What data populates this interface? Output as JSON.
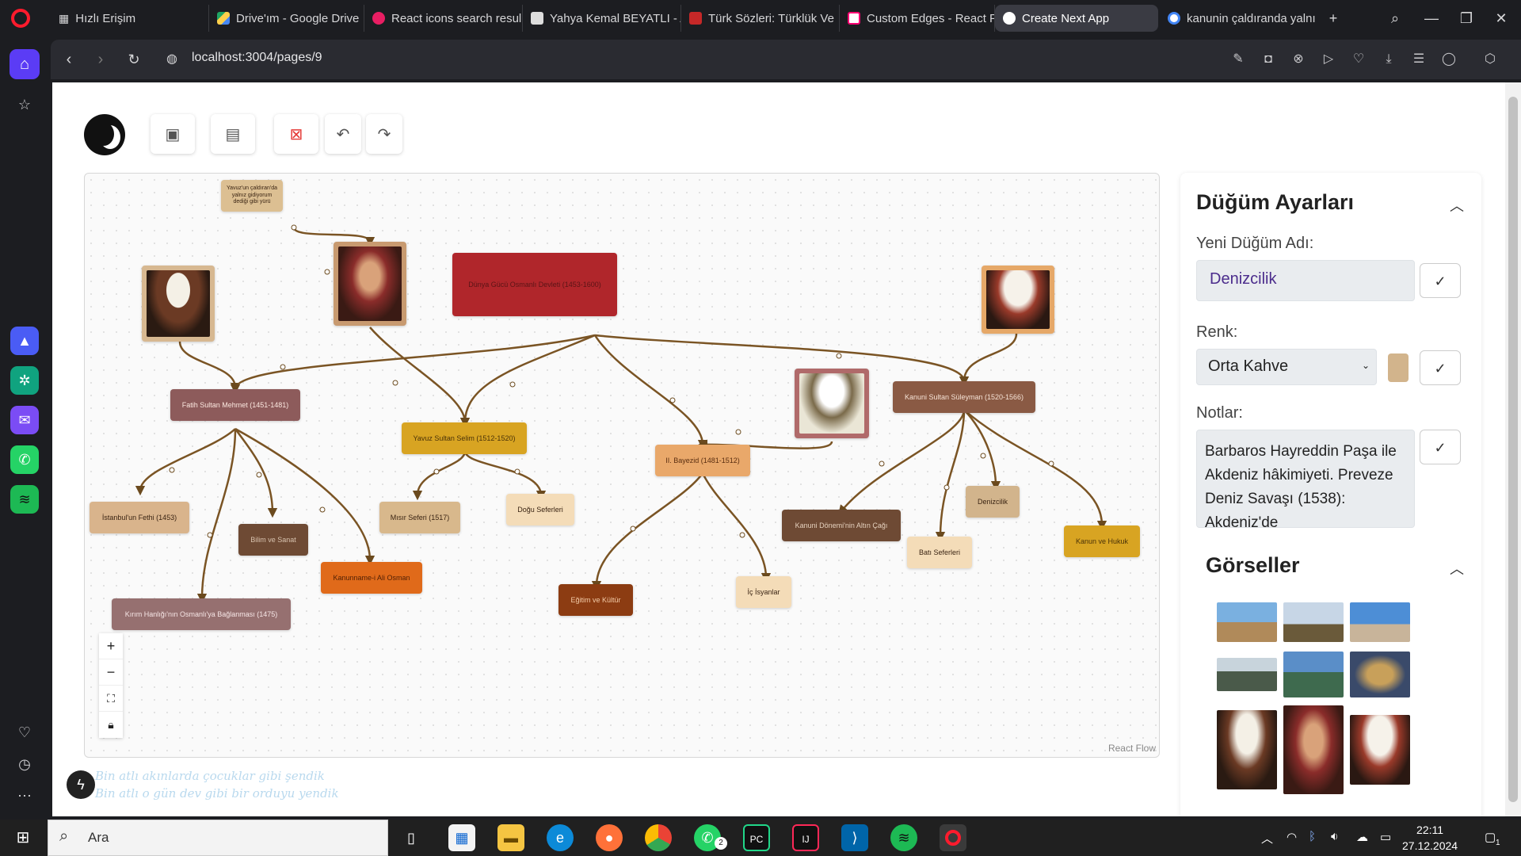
{
  "browser": {
    "tabs": [
      {
        "label": "Hızlı Erişim"
      },
      {
        "label": "Drive'ım - Google Drive"
      },
      {
        "label": "React icons search resul"
      },
      {
        "label": "Yahya Kemal BEYATLI - A"
      },
      {
        "label": "Türk Sözleri: Türklük Ve"
      },
      {
        "label": "Custom Edges - React Fl"
      },
      {
        "label": "Create Next App"
      },
      {
        "label": "kanunin çaldıranda yalnı"
      }
    ],
    "url": "localhost:3004/pages/9"
  },
  "flow": {
    "nodes": [
      {
        "label": "Yavuz'un çaldıran'da yalnız gidiyorum dediği gibi yürü"
      },
      {
        "label": "Dünya Gücü Osmanlı Devleti (1453-1600)"
      },
      {
        "label": "Fatih Sultan Mehmet (1451-1481)"
      },
      {
        "label": "Yavuz Sultan Selim (1512-1520)"
      },
      {
        "label": "II. Bayezid (1481-1512)"
      },
      {
        "label": "Kanuni Sultan Süleyman (1520-1566)"
      },
      {
        "label": "İstanbul'un Fethi (1453)"
      },
      {
        "label": "Bilim ve Sanat"
      },
      {
        "label": "Kanunname-i Ali Osman"
      },
      {
        "label": "Kırım Hanlığı'nın Osmanlı'ya Bağlanması (1475)"
      },
      {
        "label": "Mısır Seferi (1517)"
      },
      {
        "label": "Doğu Seferleri"
      },
      {
        "label": "Eğitim ve Kültür"
      },
      {
        "label": "İç İsyanlar"
      },
      {
        "label": "Kanuni Dönemi'nin Altın Çağı"
      },
      {
        "label": "Batı Seferleri"
      },
      {
        "label": "Denizcilik"
      },
      {
        "label": "Kanun ve Hukuk"
      }
    ],
    "attribution": "React Flow"
  },
  "poem": {
    "line1": "Bin atlı akınlarda çocuklar gibi şendik",
    "line2": "Bin atlı o gün dev gibi bir orduyu yendik"
  },
  "panel": {
    "title": "Düğüm Ayarları",
    "name_label": "Yeni Düğüm Adı:",
    "name_value": "Denizcilik",
    "color_label": "Renk:",
    "color_value": "Orta Kahve",
    "color_swatch": "#d2b48c",
    "notes_label": "Notlar:",
    "notes_value": "Barbaros Hayreddin Paşa ile Akdeniz hâkimiyeti. Preveze Deniz Savaşı (1538): Akdeniz'de",
    "gallery_title": "Görseller"
  },
  "taskbar": {
    "search_placeholder": "Ara",
    "time": "22:11",
    "date": "27.12.2024",
    "whatsapp_badge": "2",
    "notification_count": "1"
  }
}
